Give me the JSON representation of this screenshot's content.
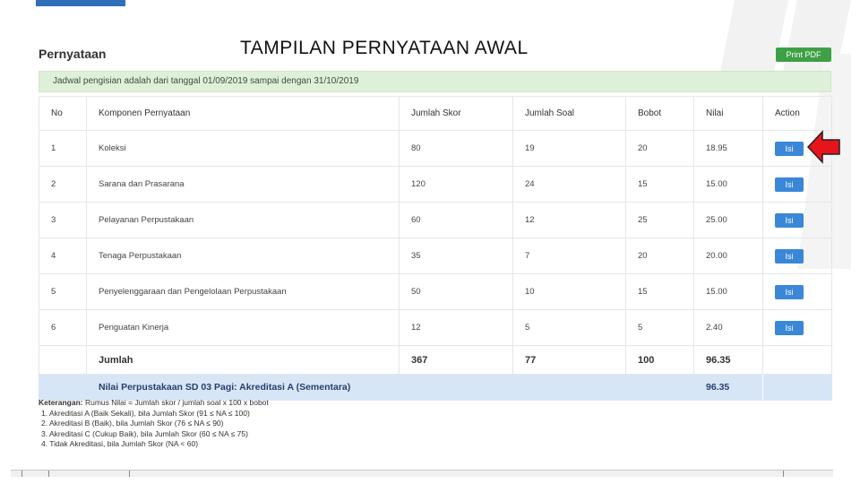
{
  "slide_title": "TAMPILAN PERNYATAAN AWAL",
  "panel": {
    "title": "Pernyataan",
    "print_button": "Print PDF",
    "schedule_notice": "Jadwal pengisian adalah dari tanggal 01/09/2019 sampai dengan 31/10/2019"
  },
  "table": {
    "headers": [
      "No",
      "Komponen Pernyataan",
      "Jumlah Skor",
      "Jumlah Soal",
      "Bobot",
      "Nilai",
      "Action"
    ],
    "rows": [
      {
        "no": "1",
        "komponen": "Koleksi",
        "skor": "80",
        "soal": "19",
        "bobot": "20",
        "nilai": "18.95",
        "action": "Isi"
      },
      {
        "no": "2",
        "komponen": "Sarana dan Prasarana",
        "skor": "120",
        "soal": "24",
        "bobot": "15",
        "nilai": "15.00",
        "action": "Isi"
      },
      {
        "no": "3",
        "komponen": "Pelayanan Perpustakaan",
        "skor": "60",
        "soal": "12",
        "bobot": "25",
        "nilai": "25.00",
        "action": "Isi"
      },
      {
        "no": "4",
        "komponen": "Tenaga Perpustakaan",
        "skor": "35",
        "soal": "7",
        "bobot": "20",
        "nilai": "20.00",
        "action": "Isi"
      },
      {
        "no": "5",
        "komponen": "Penyelenggaraan dan Pengelolaan Perpustakaan",
        "skor": "50",
        "soal": "10",
        "bobot": "15",
        "nilai": "15.00",
        "action": "Isi"
      },
      {
        "no": "6",
        "komponen": "Penguatan Kinerja",
        "skor": "12",
        "soal": "5",
        "bobot": "5",
        "nilai": "2.40",
        "action": "Isi"
      }
    ],
    "total": {
      "label": "Jumlah",
      "skor": "367",
      "soal": "77",
      "bobot": "100",
      "nilai": "96.35"
    },
    "final": {
      "label": "Nilai Perpustakaan SD 03 Pagi: Akreditasi A (Sementara)",
      "nilai": "96.35"
    }
  },
  "notes": {
    "label": "Keterangan:",
    "formula": "Rumus Nilai = Jumlah skor / jumlah soal x 100 x bobot",
    "items": [
      "1. Akreditasi A (Baik Sekali), bila Jumlah Skor (91 ≤ NA ≤ 100)",
      "2. Akreditasi B (Baik), bila Jumlah Skor (76 ≤ NA ≤ 90)",
      "3. Akreditasi C (Cukup Baik), bila Jumlah Skor (60 ≤ NA ≤ 75)",
      "4. Tidak Akreditasi, bila Jumlah Skor (NA < 60)"
    ]
  },
  "colors": {
    "accent_blue": "#2f6fb9",
    "print_green": "#3ea045",
    "isi_blue": "#3a87d8",
    "arrow_red": "#e8141b"
  }
}
